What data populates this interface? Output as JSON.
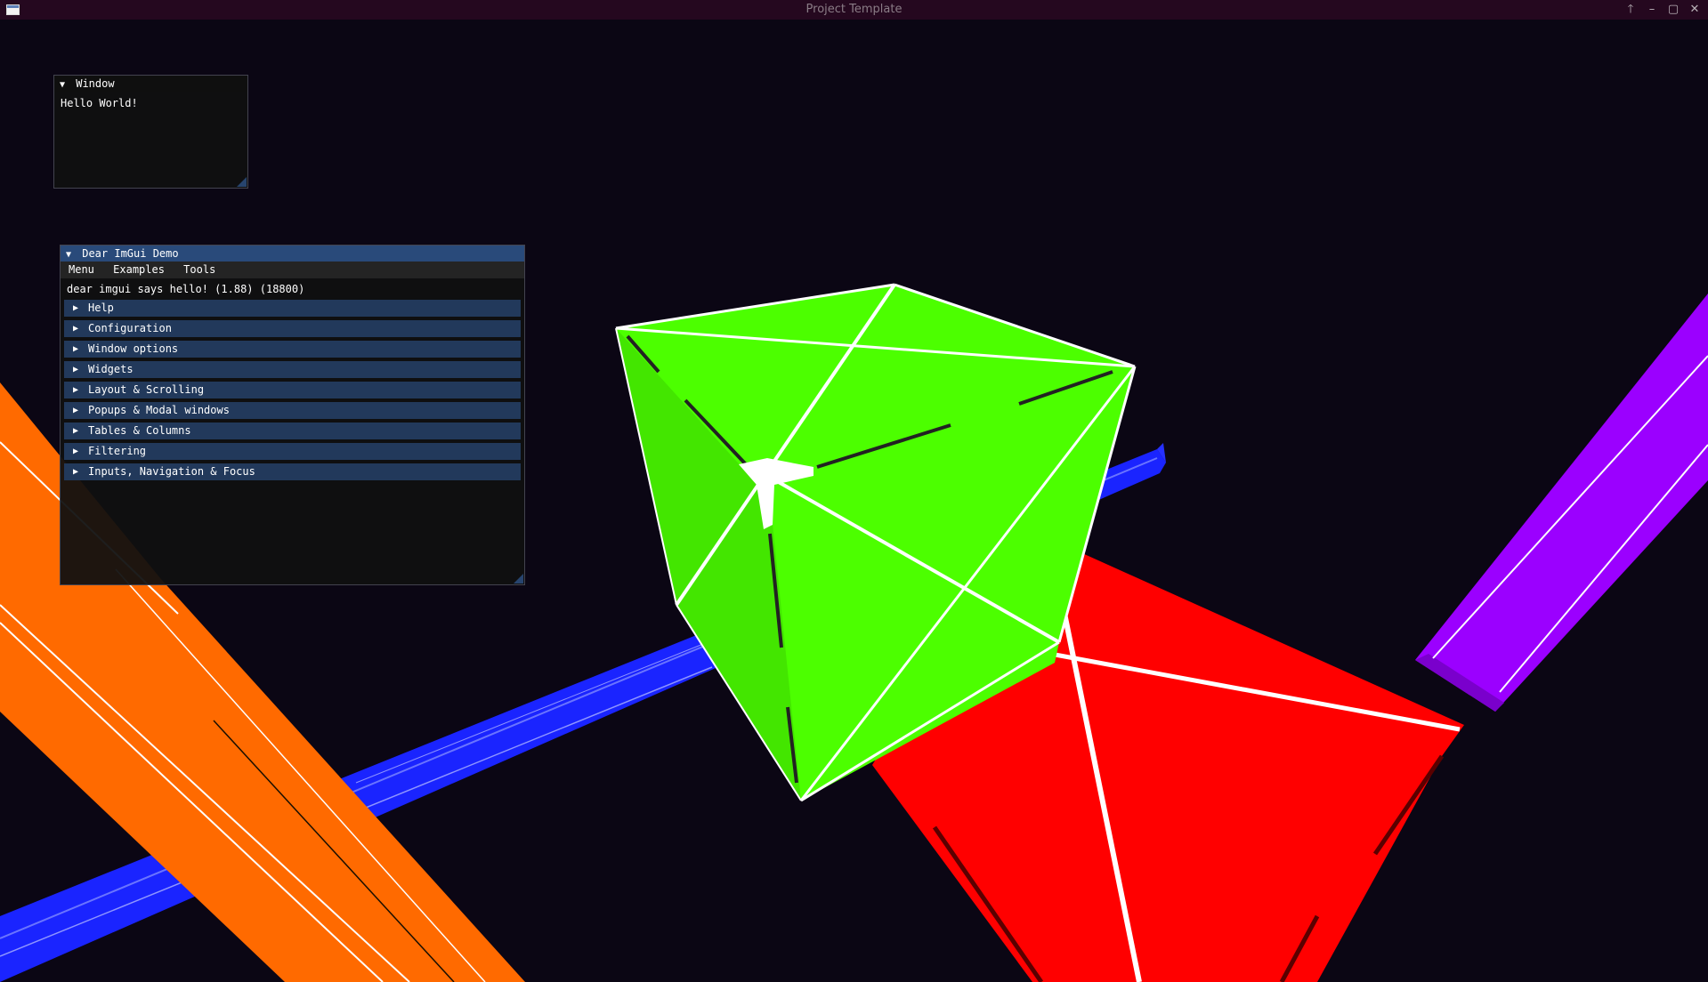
{
  "window": {
    "title": "Project Template",
    "controls": {
      "up": "🡑",
      "minimize": "–",
      "maximize": "▢",
      "close": "✕"
    }
  },
  "small_window": {
    "title": "Window",
    "arrow": "▼",
    "text": "Hello World!"
  },
  "demo_window": {
    "title": "Dear ImGui Demo",
    "arrow": "▼",
    "menu": [
      "Menu",
      "Examples",
      "Tools"
    ],
    "hello_text": "dear imgui says hello! (1.88) (18800)",
    "sections": [
      "Help",
      "Configuration",
      "Window options",
      "Widgets",
      "Layout & Scrolling",
      "Popups & Modal windows",
      "Tables & Columns",
      "Filtering",
      "Inputs, Navigation & Focus"
    ],
    "section_arrow": "▶"
  },
  "colors": {
    "background": "#0b0614",
    "titlebar": "#25081f",
    "imgui_title_active": "#294a7a",
    "imgui_header": "#22395b",
    "cube_green": "#4cff00",
    "cube_red": "#ff0000",
    "cube_blue": "#1a24ff",
    "cube_orange": "#ff6a00",
    "cube_purple": "#9b00ff"
  }
}
